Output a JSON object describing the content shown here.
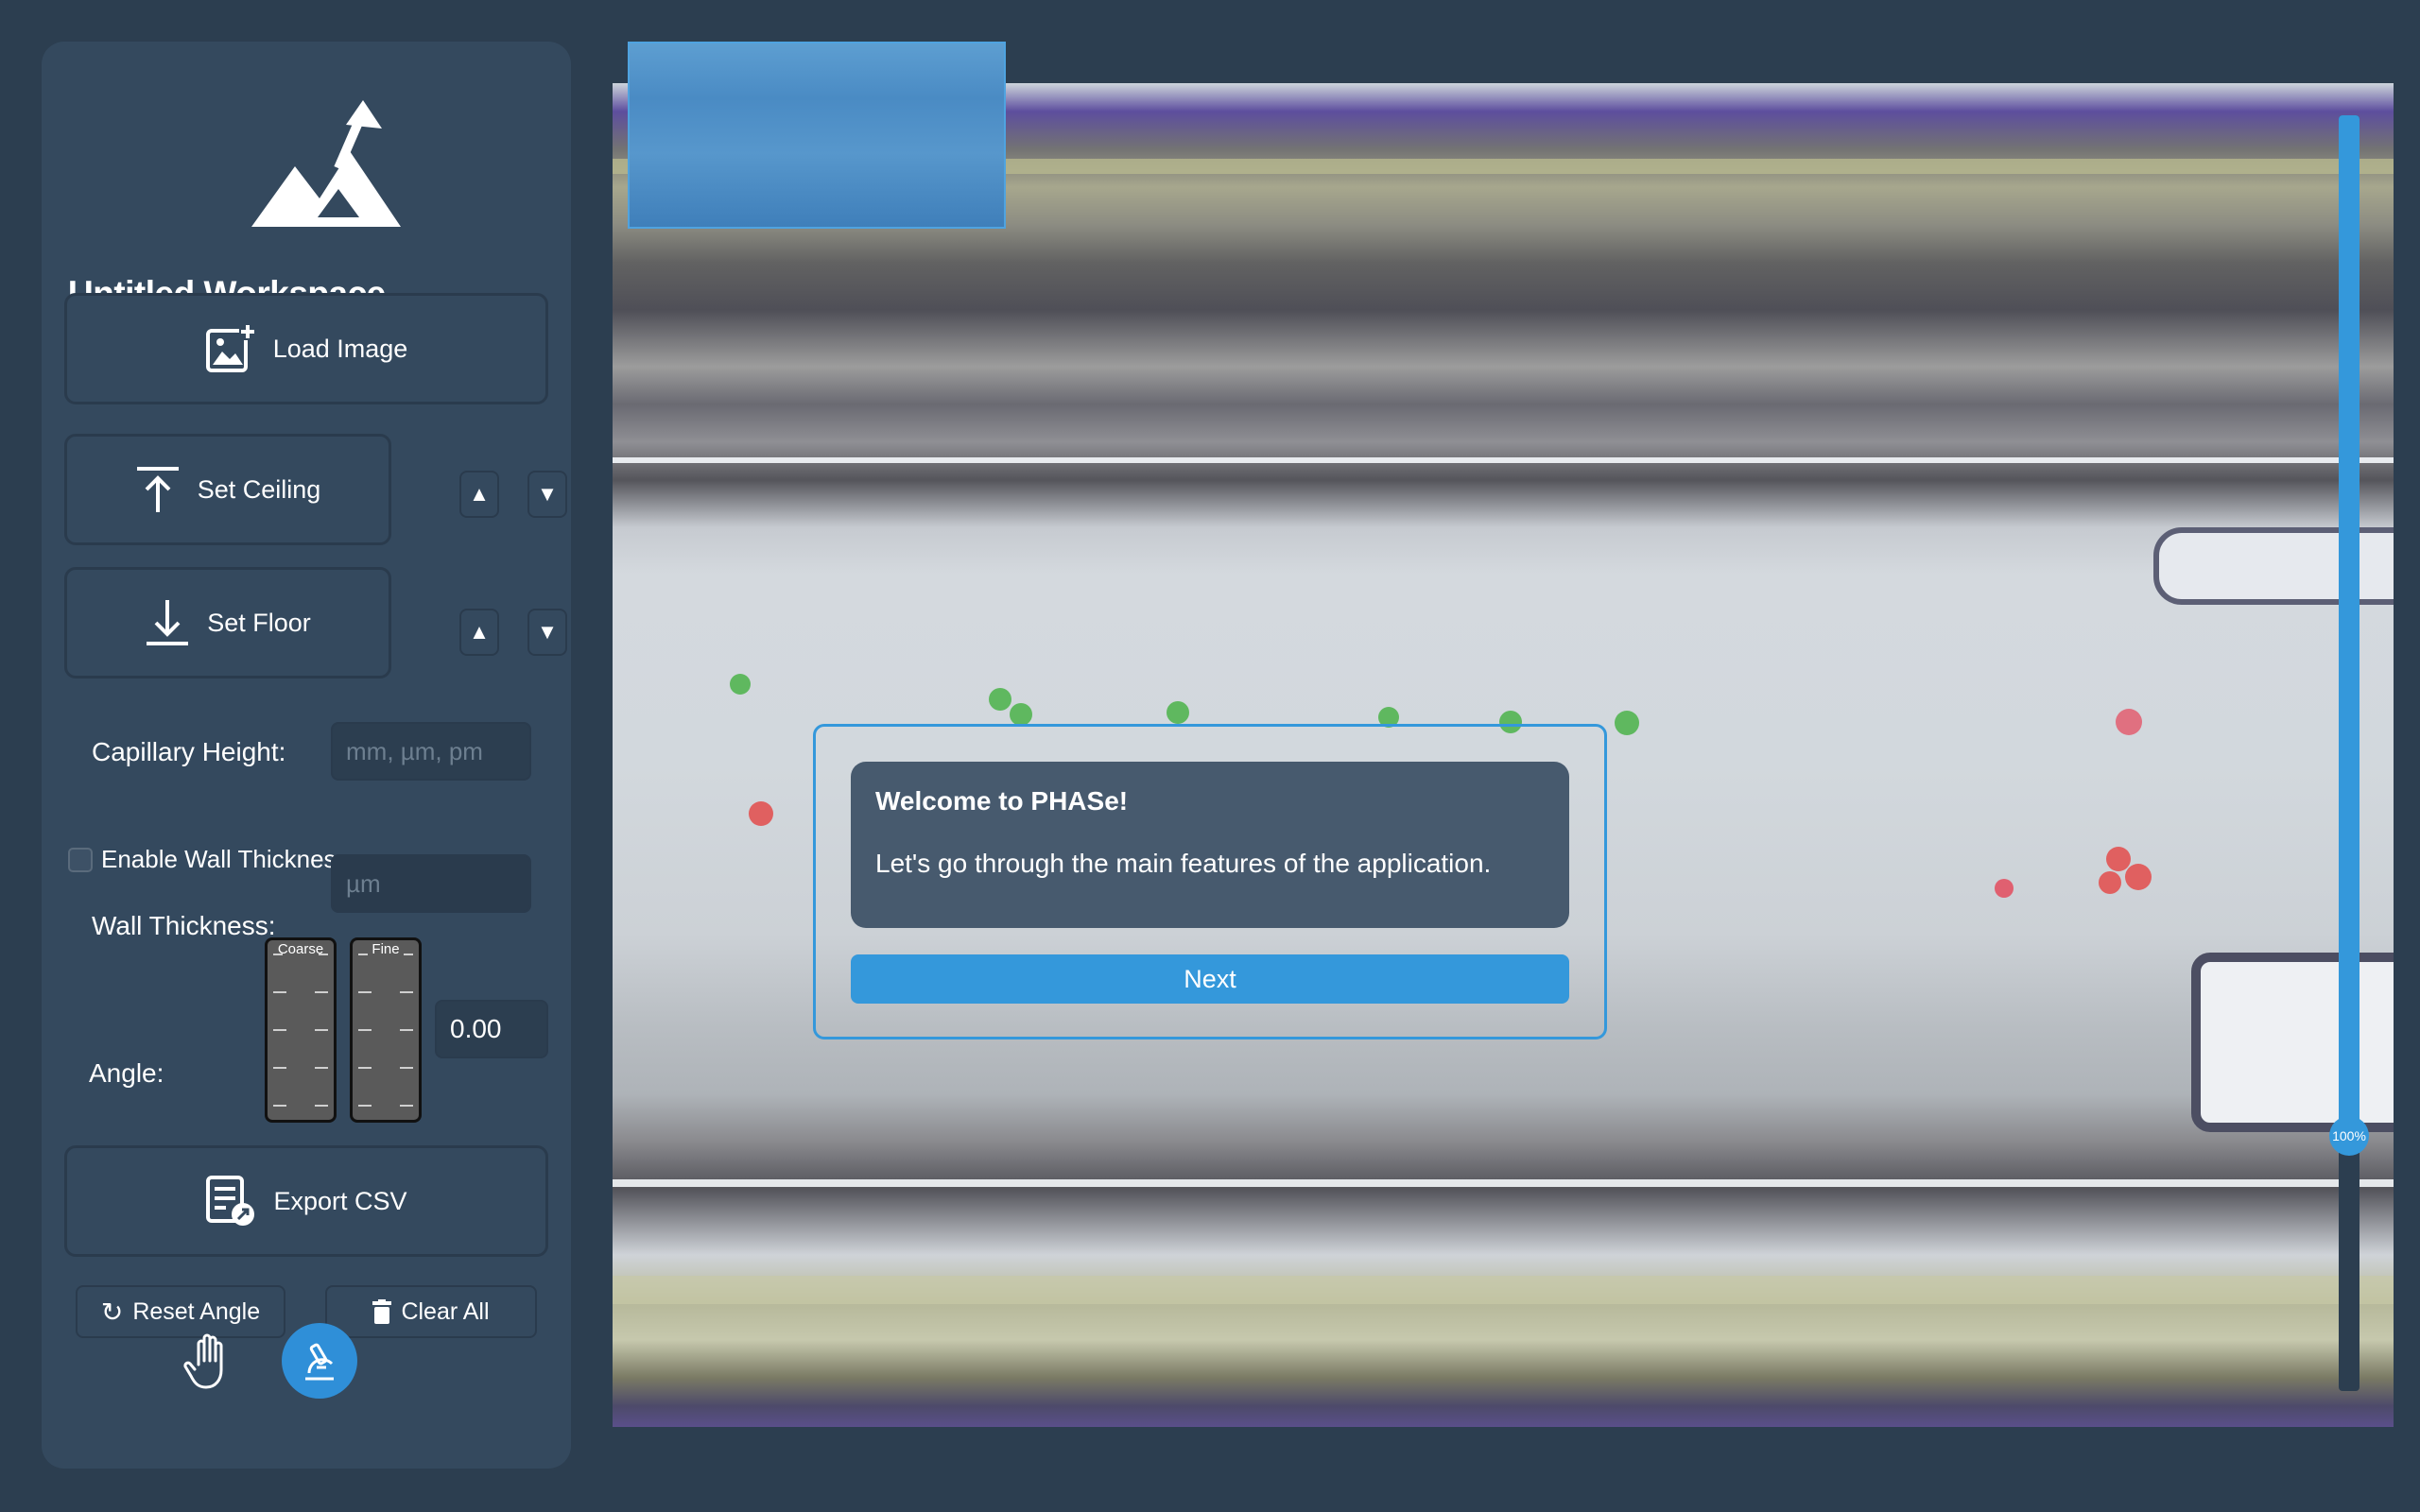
{
  "workspace": {
    "title": "Untitled Workspace"
  },
  "sidebar": {
    "load_image_label": "Load Image",
    "set_ceiling_label": "Set Ceiling",
    "set_floor_label": "Set Floor",
    "up_arrow": "▲",
    "down_arrow": "▼",
    "capillary_height": {
      "label": "Capillary Height:",
      "placeholder": "mm, µm, pm",
      "value": ""
    },
    "wall_thickness_toggle": {
      "label": "Enable Wall Thickness",
      "checked": false
    },
    "wall_thickness": {
      "label": "Wall Thickness:",
      "placeholder": "µm",
      "value": ""
    },
    "angle": {
      "label": "Angle:",
      "coarse_label": "Coarse",
      "fine_label": "Fine",
      "value": "0.00"
    },
    "export_csv_label": "Export CSV",
    "reset_angle_label": "Reset Angle",
    "clear_all_label": "Clear All",
    "tools": {
      "pan": "hand-icon",
      "measure": "microscope-icon",
      "active": "measure"
    }
  },
  "viewer": {
    "zoom_label": "100%",
    "zoom_level": 0.8
  },
  "tour": {
    "title": "Welcome to PHASe!",
    "text": "Let's go through the main features of the application.",
    "next_label": "Next"
  },
  "colors": {
    "accent": "#3498db",
    "sidebar": "#34495e",
    "background": "#2c3e50"
  }
}
